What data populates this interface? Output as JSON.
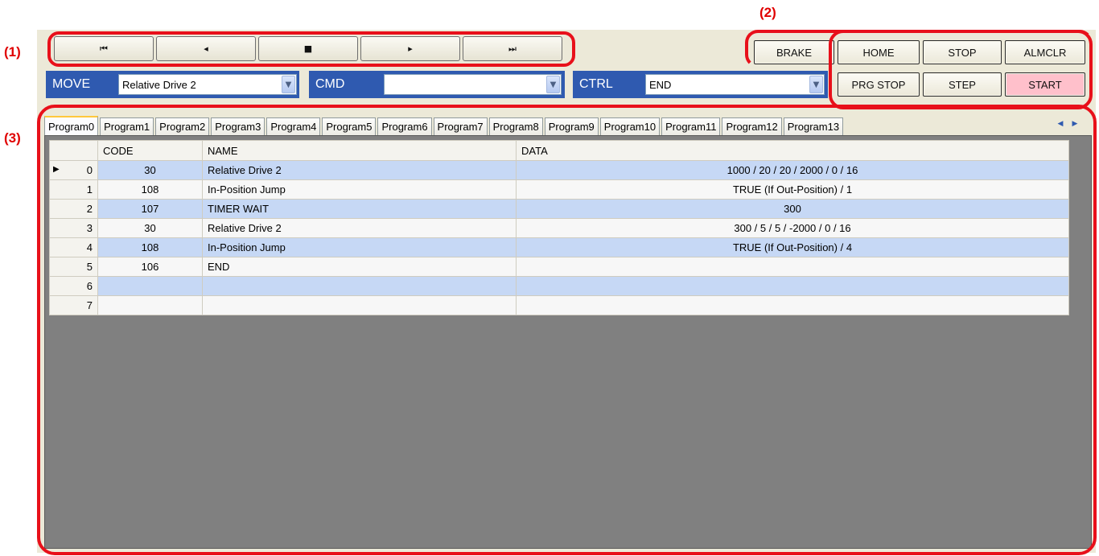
{
  "callouts": {
    "one": "(1)",
    "two": "(2)",
    "three": "(3)"
  },
  "nav": {
    "first": "⏮",
    "prev": "◂",
    "stop": "■",
    "next": "▸",
    "last": "⏭"
  },
  "control_buttons": {
    "brake": "BRAKE",
    "home": "HOME",
    "stop": "STOP",
    "almclr": "ALMCLR",
    "prg_stop": "PRG STOP",
    "step": "STEP",
    "start": "START"
  },
  "selectors": {
    "move": {
      "label": "MOVE",
      "value": "Relative Drive 2"
    },
    "cmd": {
      "label": "CMD",
      "value": ""
    },
    "ctrl": {
      "label": "CTRL",
      "value": "END"
    }
  },
  "tabs": [
    "Program0",
    "Program1",
    "Program2",
    "Program3",
    "Program4",
    "Program5",
    "Program6",
    "Program7",
    "Program8",
    "Program9",
    "Program10",
    "Program11",
    "Program12",
    "Program13"
  ],
  "active_tab": "Program0",
  "grid": {
    "columns": {
      "code": "CODE",
      "name": "NAME",
      "data": "DATA"
    },
    "current_row_marker": "▶",
    "rows": [
      {
        "index": "0",
        "code": "30",
        "name": "Relative Drive 2",
        "data": "1000 / 20 / 20 / 2000 / 0 / 16"
      },
      {
        "index": "1",
        "code": "108",
        "name": "In-Position Jump",
        "data": "TRUE (If Out-Position) / 1"
      },
      {
        "index": "2",
        "code": "107",
        "name": "TIMER WAIT",
        "data": "300"
      },
      {
        "index": "3",
        "code": "30",
        "name": "Relative Drive 2",
        "data": "300 / 5 / 5 / -2000 / 0 / 16"
      },
      {
        "index": "4",
        "code": "108",
        "name": "In-Position Jump",
        "data": "TRUE (If Out-Position) / 4"
      },
      {
        "index": "5",
        "code": "106",
        "name": "END",
        "data": ""
      },
      {
        "index": "6",
        "code": "",
        "name": "",
        "data": ""
      },
      {
        "index": "7",
        "code": "",
        "name": "",
        "data": ""
      }
    ]
  },
  "colors": {
    "highlight": "#e8101a",
    "label_blue": "#2f5ab0",
    "start_pink": "#ffc0cb",
    "row_blue": "#c6d8f5"
  }
}
